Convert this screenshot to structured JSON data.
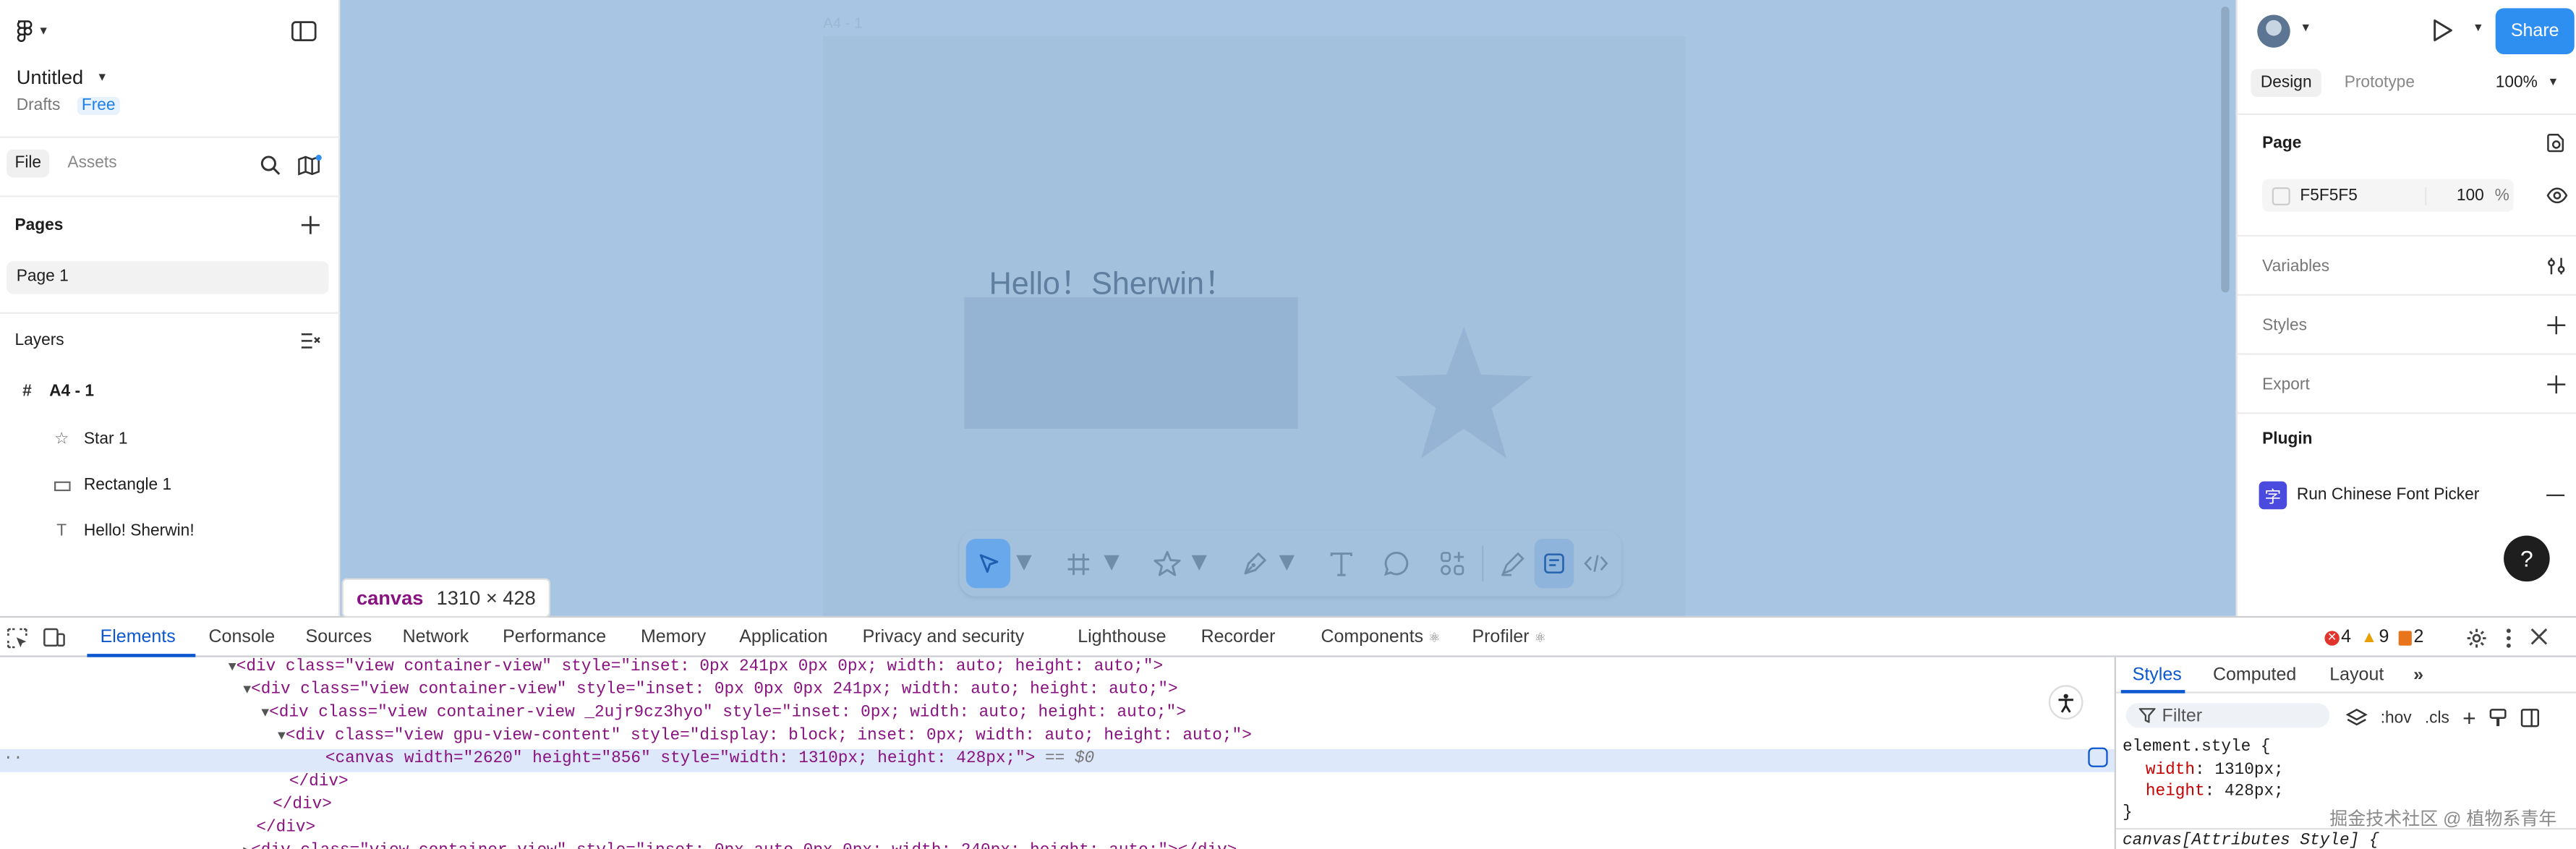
{
  "left_panel": {
    "file_title": "Untitled",
    "drafts": "Drafts",
    "plan_badge": "Free",
    "tabs": [
      "File",
      "Assets"
    ],
    "pages_heading": "Pages",
    "pages": [
      "Page 1"
    ],
    "layers_heading": "Layers",
    "layers": {
      "frame": "A4 - 1",
      "children": [
        "Star 1",
        "Rectangle 1",
        "Hello! Sherwin!"
      ]
    }
  },
  "canvas": {
    "frame_label": "A4 - 1",
    "text_layer": "Hello！Sherwin！",
    "background": "#a8c5e3",
    "inspect_tooltip": {
      "tag": "canvas",
      "size": "1310 × 428"
    }
  },
  "toolbar": {
    "tools": [
      "move-icon",
      "frame-icon",
      "star-shape-icon",
      "pen-icon",
      "text-icon",
      "comment-icon",
      "components-icon",
      "draw-icon",
      "dev-mode-icon",
      "code-icon"
    ]
  },
  "right_panel": {
    "share_label": "Share",
    "tabs": [
      "Design",
      "Prototype"
    ],
    "zoom": "100%",
    "page_heading": "Page",
    "page_color": "F5F5F5",
    "page_opacity": "100",
    "percent": "%",
    "variables": "Variables",
    "styles": "Styles",
    "export": "Export",
    "plugin_heading": "Plugin",
    "plugin_glyph": "字",
    "plugin_name": "Run Chinese Font Picker",
    "help": "?",
    "accent": "#2f8ff0"
  },
  "devtools": {
    "tabs": [
      "Elements",
      "Console",
      "Sources",
      "Network",
      "Performance",
      "Memory",
      "Application",
      "Privacy and security",
      "Lighthouse",
      "Recorder",
      "Components",
      "Profiler"
    ],
    "errors": "4",
    "warnings": "9",
    "issues": "2",
    "dom": [
      "<div class=\"view container-view\" style=\"inset: 0px 241px 0px 0px; width: auto; height: auto;\">",
      "<div class=\"view container-view\" style=\"inset: 0px 0px 0px 241px; width: auto; height: auto;\">",
      "<div class=\"view container-view _2ujr9cz3hyo\" style=\"inset: 0px; width: auto; height: auto;\">",
      "<div class=\"view gpu-view-content\" style=\"display: block; inset: 0px; width: auto; height: auto;\">",
      "<canvas width=\"2620\" height=\"856\" style=\"width: 1310px; height: 428px;\">",
      "</div>",
      "</div>",
      "</div>",
      "<div class=\"view container-view\" style=\"inset: 0px auto 0px 0px; width: 240px; height: auto;\"></div>"
    ],
    "selected_marker": "== $0",
    "styles_tabs": [
      "Styles",
      "Computed",
      "Layout"
    ],
    "filter_placeholder": "Filter",
    "hov": ":hov",
    "cls": ".cls",
    "css": {
      "selector": "element.style {",
      "width_prop": "width",
      "width_val": "1310px;",
      "height_prop": "height",
      "height_val": "428px;",
      "close": "}",
      "attr_rule": "canvas[Attributes Style] {"
    }
  },
  "watermark": "掘金技术社区 @ 植物系青年"
}
